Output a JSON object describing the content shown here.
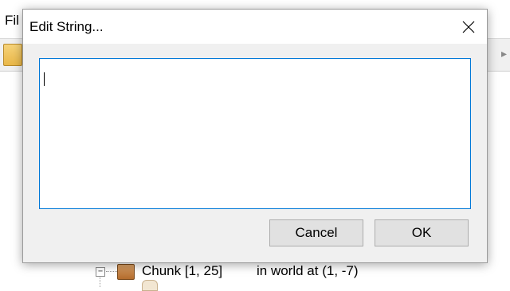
{
  "app": {
    "menu_file_label": "Fil",
    "toolbar_icon": "folder-icon",
    "tree": {
      "row_label": "Chunk [1, 25]",
      "row_desc": "in world at (1, -7)",
      "expander_symbol": "−",
      "row_icon": "chunk-icon"
    }
  },
  "dialog": {
    "title": "Edit String...",
    "close_icon": "close-icon",
    "input_value": "",
    "cancel_label": "Cancel",
    "ok_label": "OK"
  },
  "colors": {
    "focus_border": "#0078d7",
    "dialog_bg": "#f0f0f0",
    "button_bg": "#e1e1e1"
  }
}
